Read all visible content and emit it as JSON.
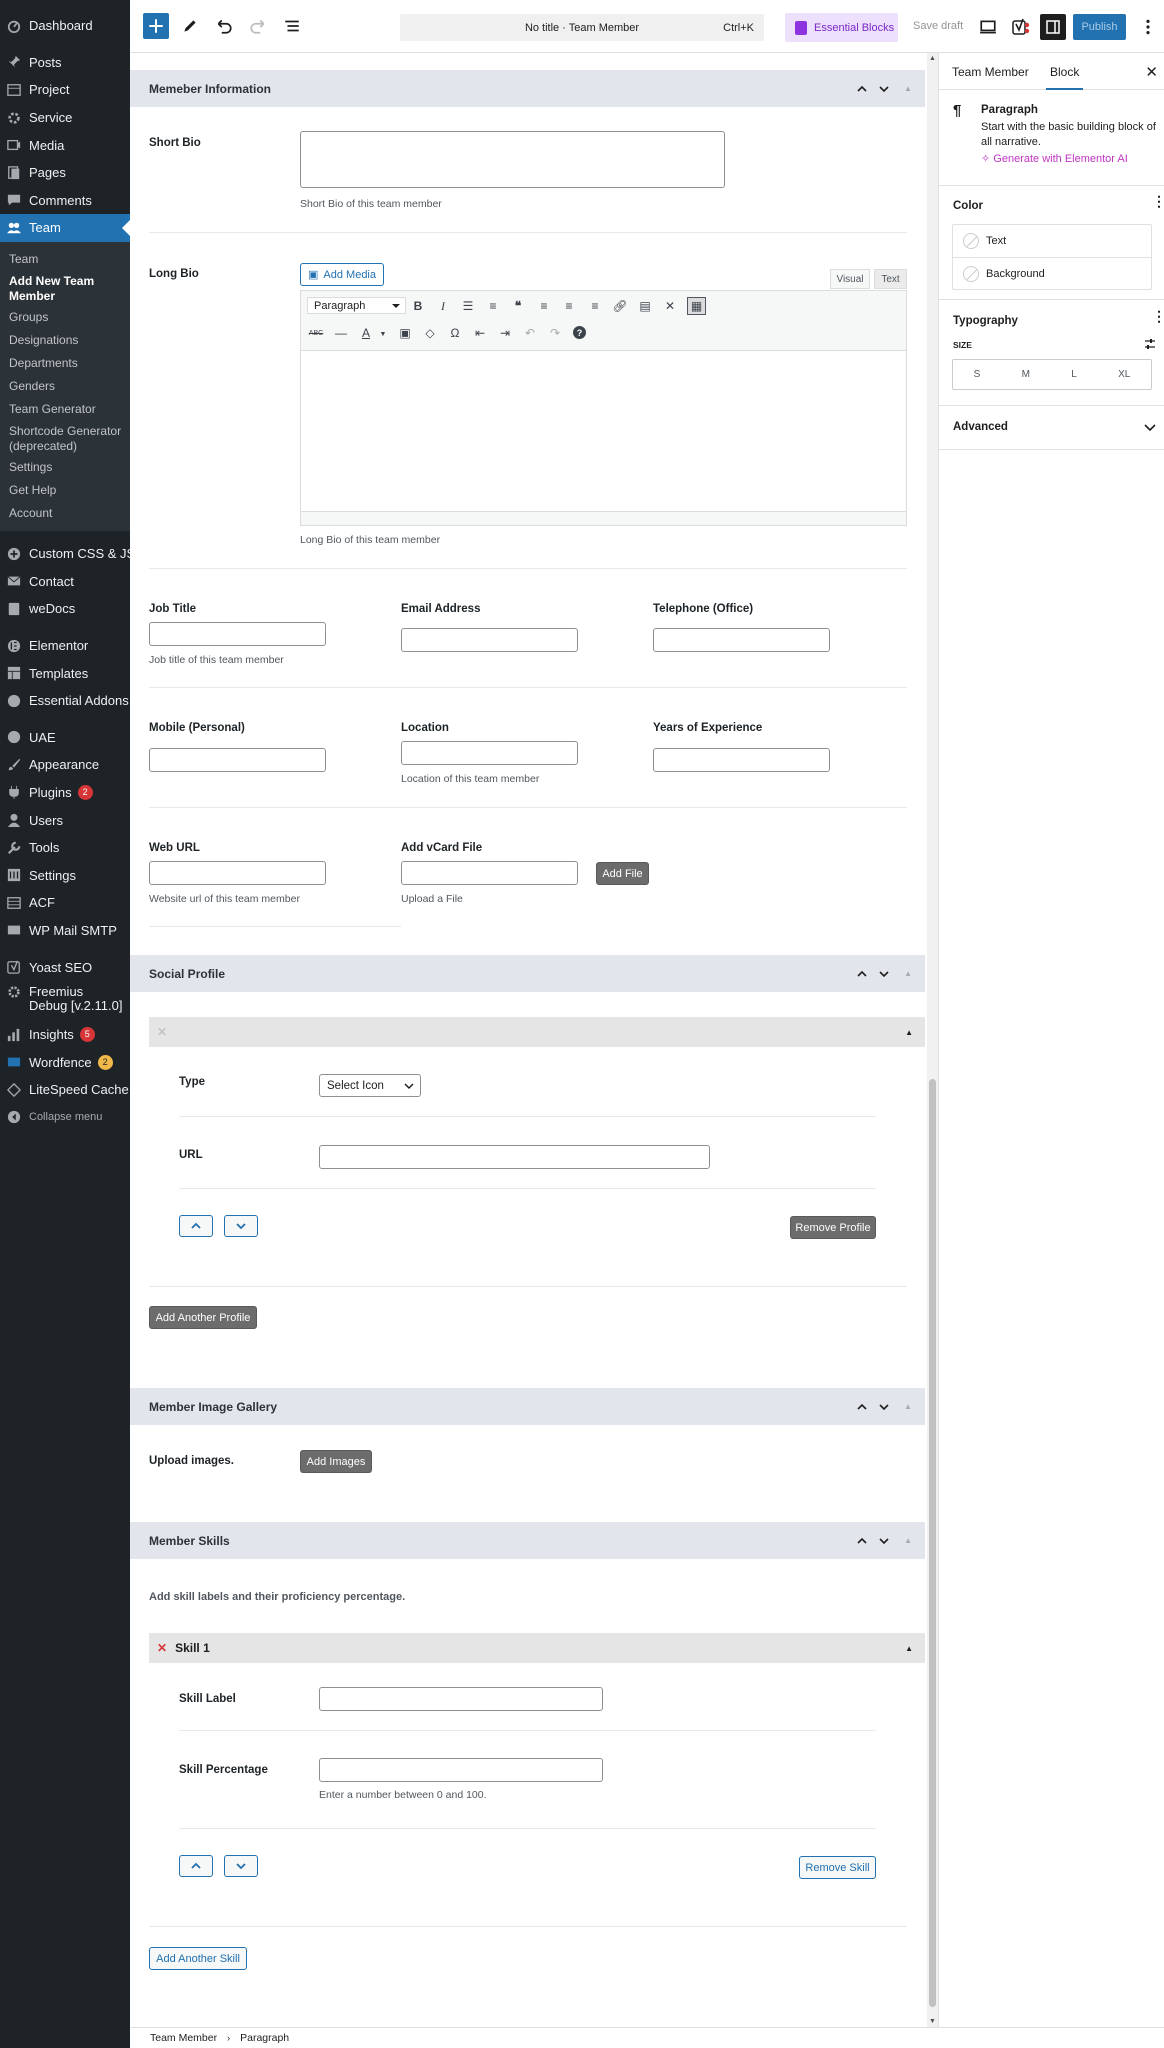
{
  "admin_menu": {
    "top": [
      {
        "label": "Dashboard",
        "icon": "dashboard-icon"
      },
      {
        "label": "Posts",
        "icon": "pin-icon"
      },
      {
        "label": "Project",
        "icon": "project-icon"
      },
      {
        "label": "Service",
        "icon": "service-icon"
      },
      {
        "label": "Media",
        "icon": "media-icon"
      },
      {
        "label": "Pages",
        "icon": "pages-icon"
      },
      {
        "label": "Comments",
        "icon": "comments-icon"
      },
      {
        "label": "Team",
        "icon": "team-icon"
      }
    ],
    "team_submenu": [
      "Team",
      "Add New Team Member",
      "Groups",
      "Designations",
      "Departments",
      "Genders",
      "Team Generator",
      "Shortcode Generator (deprecated)",
      "Settings",
      "Get Help",
      "Account"
    ],
    "group2": [
      {
        "label": "Custom CSS & JS",
        "icon": "plus-circle-icon"
      },
      {
        "label": "Contact",
        "icon": "mail-icon"
      },
      {
        "label": "weDocs",
        "icon": "docs-icon"
      }
    ],
    "group3": [
      {
        "label": "Elementor",
        "icon": "elementor-icon"
      },
      {
        "label": "Templates",
        "icon": "templates-icon"
      },
      {
        "label": "Essential Addons",
        "icon": "ea-icon"
      }
    ],
    "group4": [
      {
        "label": "UAE",
        "icon": "uae-icon"
      },
      {
        "label": "Appearance",
        "icon": "brush-icon"
      },
      {
        "label": "Plugins",
        "icon": "plugin-icon",
        "badge": "2"
      },
      {
        "label": "Users",
        "icon": "users-icon"
      },
      {
        "label": "Tools",
        "icon": "wrench-icon"
      },
      {
        "label": "Settings",
        "icon": "settings-icon"
      },
      {
        "label": "ACF",
        "icon": "acf-icon"
      },
      {
        "label": "WP Mail SMTP",
        "icon": "smtp-icon"
      }
    ],
    "group5": [
      {
        "label": "Yoast SEO",
        "icon": "yoast-icon"
      },
      {
        "label": "Freemius Debug [v.2.11.0]",
        "icon": "gear-icon"
      },
      {
        "label": "Insights",
        "icon": "insights-icon",
        "badge": "5"
      },
      {
        "label": "Wordfence",
        "icon": "wordfence-icon",
        "badge": "2"
      },
      {
        "label": "LiteSpeed Cache",
        "icon": "litespeed-icon"
      },
      {
        "label": "Collapse menu",
        "icon": "collapse-icon"
      }
    ]
  },
  "topbar": {
    "command": "No title · Team Member",
    "shortcut": "Ctrl+K",
    "essential_blocks": "Essential Blocks",
    "save_draft": "Save draft",
    "publish": "Publish"
  },
  "sections": {
    "info_title": "Memeber Information",
    "short_bio_label": "Short Bio",
    "short_bio_desc": "Short Bio of this team member",
    "long_bio_label": "Long Bio",
    "add_media": "Add Media",
    "tab_visual": "Visual",
    "tab_text": "Text",
    "paragraph": "Paragraph",
    "long_bio_desc": "Long Bio of this team member",
    "job_title": "Job Title",
    "job_title_desc": "Job title of this team member",
    "email": "Email Address",
    "telephone": "Telephone (Office)",
    "mobile": "Mobile (Personal)",
    "location": "Location",
    "location_desc": "Location of this team member",
    "years": "Years of Experience",
    "web_url": "Web URL",
    "web_url_desc": "Website url of this team member",
    "vcard": "Add vCard File",
    "add_file": "Add File",
    "vcard_desc": "Upload a File",
    "social_title": "Social Profile",
    "type": "Type",
    "select_icon": "Select Icon",
    "url": "URL",
    "remove_profile": "Remove Profile",
    "add_profile": "Add Another Profile",
    "gallery_title": "Member Image Gallery",
    "upload_images": "Upload images.",
    "add_images": "Add Images",
    "skills_title": "Member Skills",
    "skills_desc": "Add skill labels and their proficiency percentage.",
    "skill1": "Skill 1",
    "skill_label": "Skill Label",
    "skill_pct": "Skill Percentage",
    "skill_pct_desc": "Enter a number between 0 and 100.",
    "remove_skill": "Remove Skill",
    "add_skill": "Add Another Skill"
  },
  "side": {
    "tab1": "Team Member",
    "tab2": "Block",
    "block_name": "Paragraph",
    "block_desc": "Start with the basic building block of all narrative.",
    "gen_ai": "Generate with Elementor AI",
    "color": "Color",
    "text": "Text",
    "background": "Background",
    "typography": "Typography",
    "size": "SIZE",
    "sizes": [
      "S",
      "M",
      "L",
      "XL"
    ],
    "advanced": "Advanced"
  },
  "footer": {
    "crumb1": "Team Member",
    "crumb2": "Paragraph"
  }
}
